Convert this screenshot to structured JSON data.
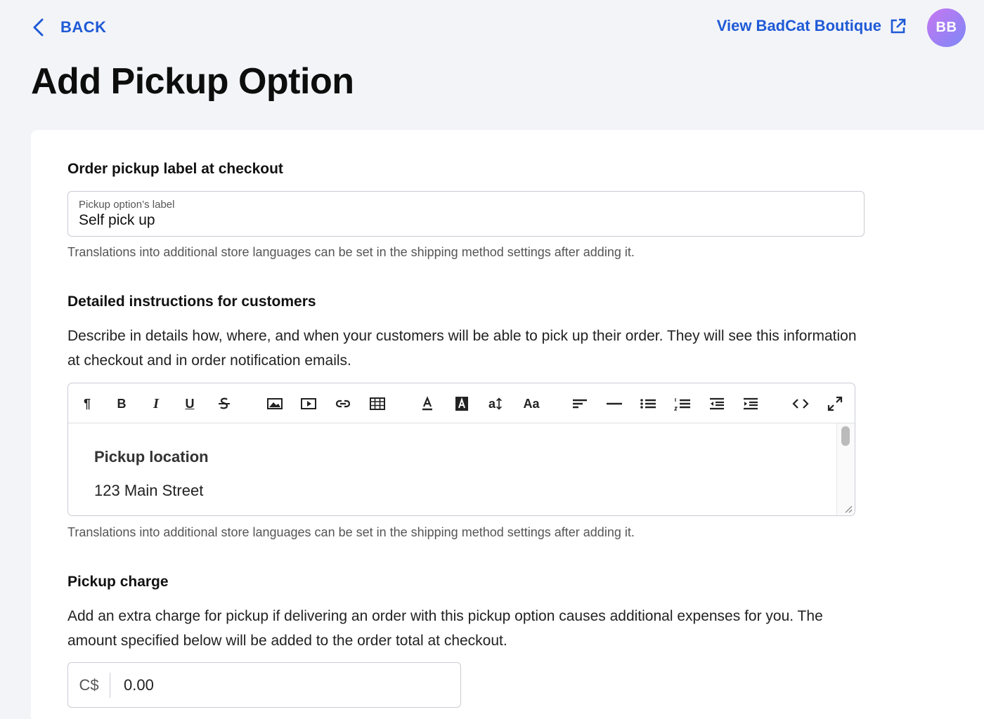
{
  "header": {
    "back_label": "BACK",
    "view_store_label": "View BadCat Boutique",
    "avatar_initials": "BB"
  },
  "page": {
    "title": "Add Pickup Option"
  },
  "pickup_label_section": {
    "title": "Order pickup label at checkout",
    "field_label": "Pickup option’s label",
    "field_value": "Self pick up",
    "hint": "Translations into additional store languages can be set in the shipping method settings after adding it."
  },
  "instructions_section": {
    "title": "Detailed instructions for customers",
    "description": "Describe in details how, where, and when your customers will be able to pick up their order. They will see this information at checkout and in order notification emails.",
    "toolbar": {
      "paragraph": "¶",
      "bold": "B",
      "italic": "I",
      "underline": "U",
      "text_size": "a",
      "font": "Aa"
    },
    "editor_heading": "Pickup location",
    "editor_text": "123 Main Street",
    "hint": "Translations into additional store languages can be set in the shipping method settings after adding it."
  },
  "charge_section": {
    "title": "Pickup charge",
    "description": "Add an extra charge for pickup if delivering an order with this pickup option causes additional expenses for you. The amount specified below will be added to the order total at checkout.",
    "currency": "C$",
    "amount": "0.00"
  },
  "colors": {
    "accent": "#1f5ad6",
    "background": "#f3f4f8"
  }
}
